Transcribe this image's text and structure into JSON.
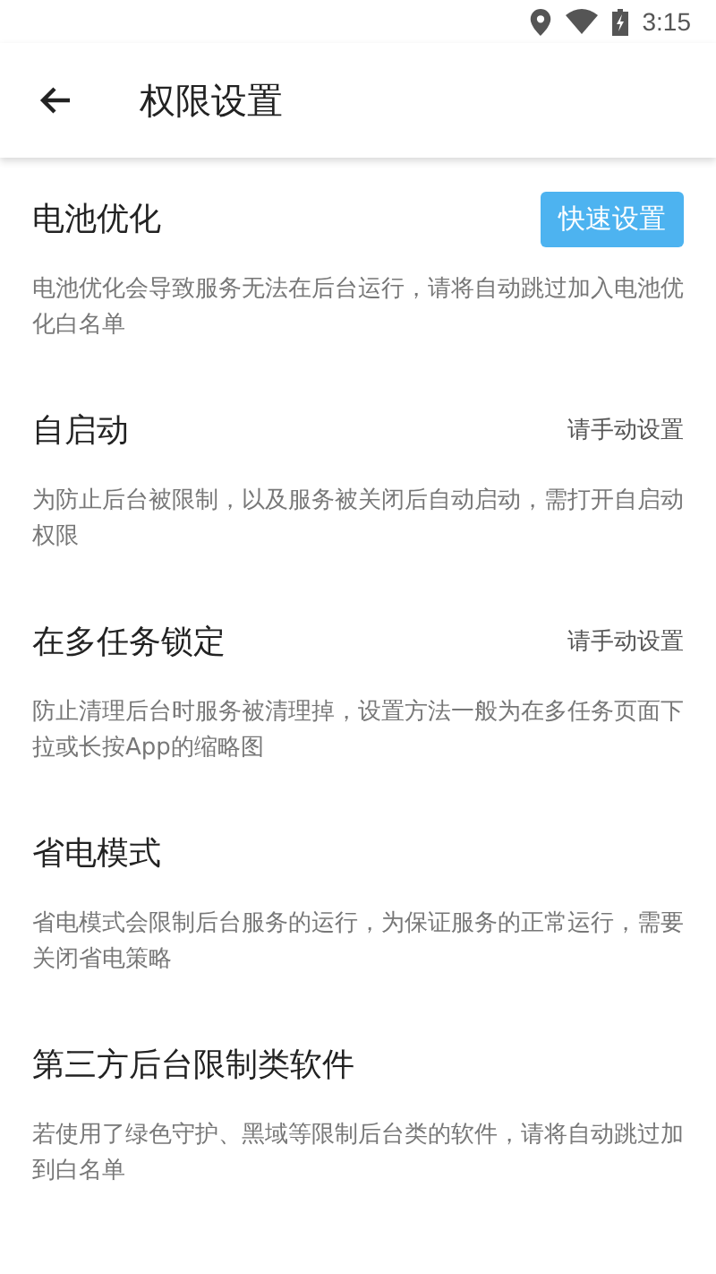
{
  "status_bar": {
    "time": "3:15"
  },
  "toolbar": {
    "title": "权限设置"
  },
  "sections": [
    {
      "title": "电池优化",
      "kind": "button",
      "action": "快速设置",
      "description": "电池优化会导致服务无法在后台运行，请将自动跳过加入电池优化白名单"
    },
    {
      "title": "自启动",
      "kind": "text",
      "action": "请手动设置",
      "description": "为防止后台被限制，以及服务被关闭后自动启动，需打开自启动权限"
    },
    {
      "title": "在多任务锁定",
      "kind": "text",
      "action": "请手动设置",
      "description": "防止清理后台时服务被清理掉，设置方法一般为在多任务页面下拉或长按App的缩略图"
    },
    {
      "title": "省电模式",
      "kind": "none",
      "description": "省电模式会限制后台服务的运行，为保证服务的正常运行，需要关闭省电策略"
    },
    {
      "title": "第三方后台限制类软件",
      "kind": "none",
      "description": "若使用了绿色守护、黑域等限制后台类的软件，请将自动跳过加到白名单"
    }
  ]
}
